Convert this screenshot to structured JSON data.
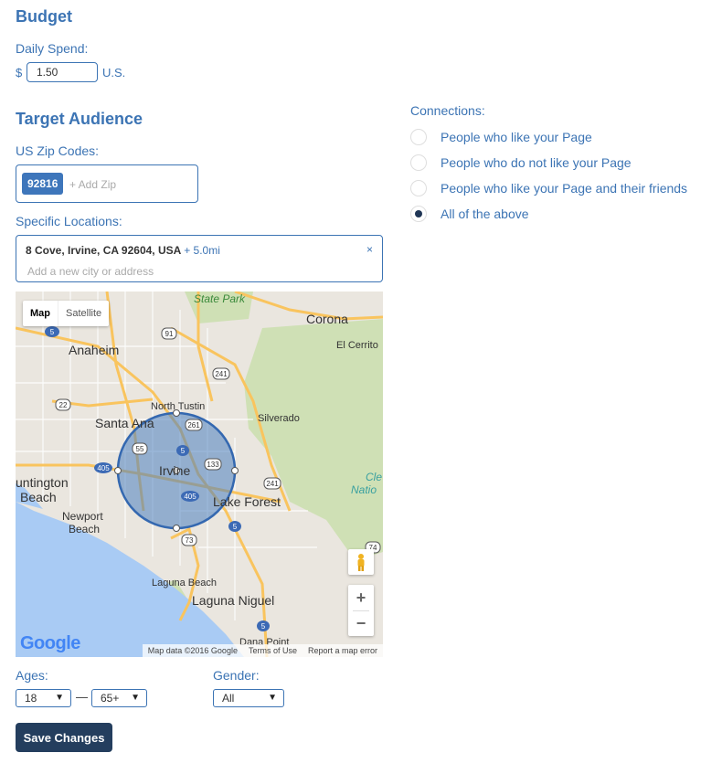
{
  "budget": {
    "title": "Budget",
    "daily_spend_label": "Daily Spend:",
    "currency_symbol": "$",
    "spend_value": "1.50",
    "currency_suffix": "U.S."
  },
  "audience": {
    "title": "Target Audience",
    "zip_label": "US Zip Codes:",
    "zip_chips": [
      "92816"
    ],
    "zip_placeholder": "+ Add Zip",
    "locations_label": "Specific Locations:",
    "location": {
      "address": "8 Cove, Irvine, CA 92604, USA",
      "radius": "+ 5.0mi",
      "remove": "×"
    },
    "location_placeholder": "Add a new city or address"
  },
  "map": {
    "type_map": "Map",
    "type_satellite": "Satellite",
    "zoom_in": "+",
    "zoom_out": "−",
    "logo": "Google",
    "attribution": [
      "Map data ©2016 Google",
      "Terms of Use",
      "Report a map error"
    ],
    "labels": {
      "state_park": "State Park",
      "corona": "Corona",
      "anaheim": "Anaheim",
      "el_cerrito": "El Cerrito",
      "north_tustin": "North Tustin",
      "santa_ana": "Santa Ana",
      "silverado": "Silverado",
      "irvine": "Irvine",
      "huntington": "untington",
      "huntington_beach": "Beach",
      "lake_forest": "Lake Forest",
      "cleveland": "Cle",
      "cleveland_nat": "Natio",
      "newport": "Newport",
      "newport_beach": "Beach",
      "laguna_beach": "Laguna Beach",
      "laguna_niguel": "Laguna Niguel",
      "dana_point": "Dana Point"
    },
    "shields": [
      "5",
      "91",
      "241",
      "22",
      "261",
      "55",
      "5",
      "133",
      "405",
      "405",
      "241",
      "5",
      "73",
      "74",
      "5"
    ],
    "colors": {
      "land": "#eae6df",
      "park": "#cfe0b5",
      "water": "#a9cbf4",
      "highway": "#f9c45e",
      "radius_fill": "#4a7fc0",
      "radius_stroke": "#3468b0"
    }
  },
  "filters": {
    "ages_label": "Ages:",
    "age_min": "18",
    "age_separator": "—",
    "age_max": "65+",
    "gender_label": "Gender:",
    "gender": "All"
  },
  "save_label": "Save Changes",
  "connections": {
    "label": "Connections:",
    "options": [
      {
        "label": "People who like your Page",
        "checked": false
      },
      {
        "label": "People who do not like your Page",
        "checked": false
      },
      {
        "label": "People who like your Page and their friends",
        "checked": false
      },
      {
        "label": "All of the above",
        "checked": true
      }
    ]
  }
}
